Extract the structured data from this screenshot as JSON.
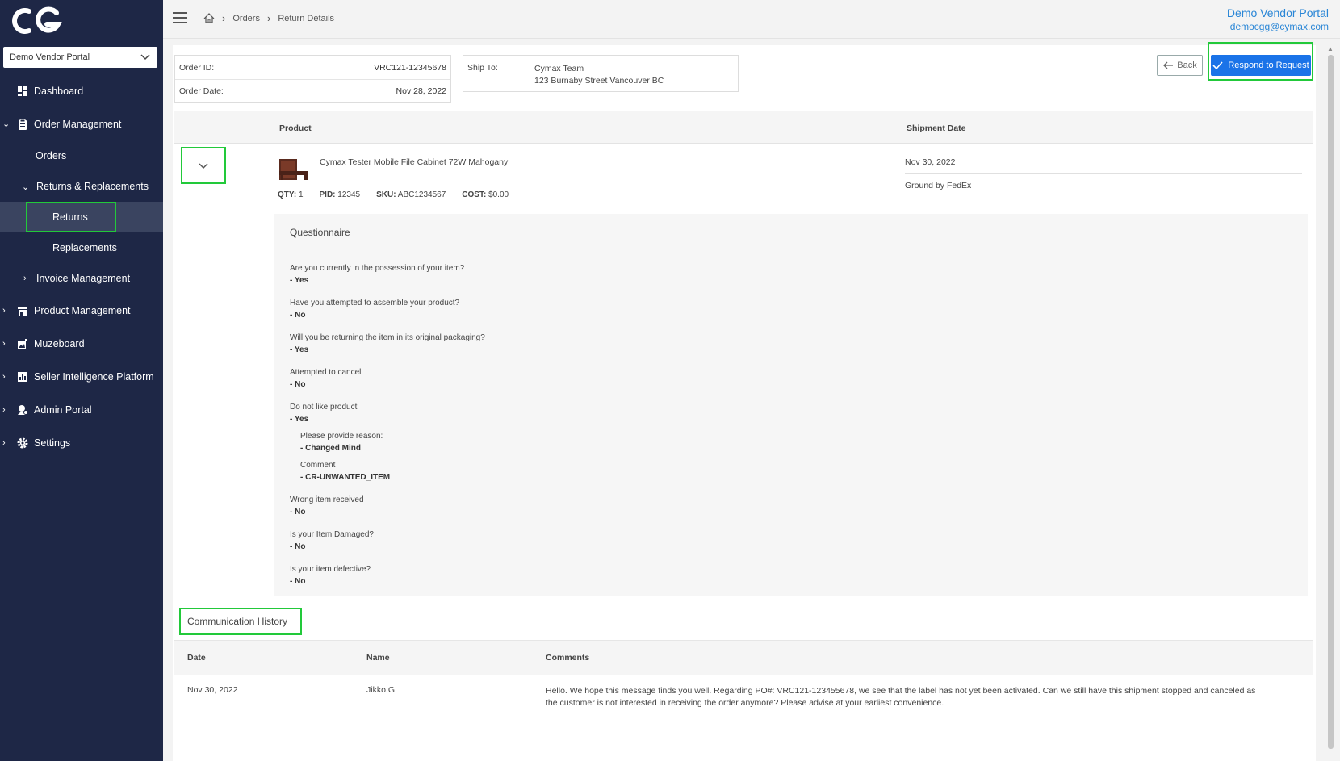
{
  "sidebar": {
    "portal_select": "Demo Vendor Portal",
    "items": [
      {
        "label": "Dashboard"
      },
      {
        "label": "Order Management"
      },
      {
        "label": "Orders"
      },
      {
        "label": "Returns & Replacements"
      },
      {
        "label": "Returns"
      },
      {
        "label": "Replacements"
      },
      {
        "label": "Invoice Management"
      },
      {
        "label": "Product Management"
      },
      {
        "label": "Muzeboard"
      },
      {
        "label": "Seller Intelligence Platform"
      },
      {
        "label": "Admin Portal"
      },
      {
        "label": "Settings"
      }
    ]
  },
  "breadcrumb": {
    "items": [
      "Orders",
      "Return Details"
    ]
  },
  "user": {
    "name": "Demo Vendor Portal",
    "email": "democgg@cymax.com"
  },
  "order": {
    "id_label": "Order ID:",
    "id_value": "VRC121-12345678",
    "date_label": "Order Date:",
    "date_value": "Nov 28, 2022",
    "ship_to_label": "Ship To:",
    "ship_to_name": "Cymax Team",
    "ship_to_address": "123 Burnaby Street Vancouver BC"
  },
  "buttons": {
    "back": "Back",
    "respond": "Respond to Request"
  },
  "table": {
    "product_header": "Product",
    "shipment_header": "Shipment Date"
  },
  "product": {
    "name": "Cymax Tester Mobile File Cabinet 72W Mahogany",
    "qty_label": "QTY:",
    "qty": "1",
    "pid_label": "PID:",
    "pid": "12345",
    "sku_label": "SKU:",
    "sku": "ABC1234567",
    "cost_label": "COST:",
    "cost": "$0.00",
    "ship_date": "Nov 30, 2022",
    "ship_method": "Ground by FedEx"
  },
  "questionnaire": {
    "title": "Questionnaire",
    "q1": {
      "q": "Are you currently in the possession of your item?",
      "a": "- Yes"
    },
    "q2": {
      "q": "Have you attempted to assemble your product?",
      "a": "- No"
    },
    "q3": {
      "q": "Will you be returning the item in its original packaging?",
      "a": "- Yes"
    },
    "q4": {
      "q": "Attempted to cancel",
      "a": "- No"
    },
    "q5": {
      "q": "Do not like product",
      "a": "- Yes",
      "reason_label": "Please provide reason:",
      "reason": "- Changed Mind",
      "comment_label": "Comment",
      "comment": "- CR-UNWANTED_ITEM"
    },
    "q6": {
      "q": "Wrong item received",
      "a": "- No"
    },
    "q7": {
      "q": "Is your Item Damaged?",
      "a": "- No"
    },
    "q8": {
      "q": "Is your item defective?",
      "a": "- No"
    }
  },
  "communication": {
    "title": "Communication History",
    "headers": {
      "date": "Date",
      "name": "Name",
      "comments": "Comments"
    },
    "rows": [
      {
        "date": "Nov 30, 2022",
        "name": "Jikko.G",
        "comments": "Hello. We hope this message finds you well. Regarding PO#: VRC121-123455678, we see that the label has not yet been activated. Can we still have this shipment stopped and canceled as the customer is not interested in receiving the order anymore? Please advise at your earliest convenience."
      }
    ]
  },
  "colors": {
    "sidebar_bg": "#1e2746",
    "accent": "#1a73e8",
    "highlight": "#22c93a",
    "link": "#2a86d6"
  }
}
